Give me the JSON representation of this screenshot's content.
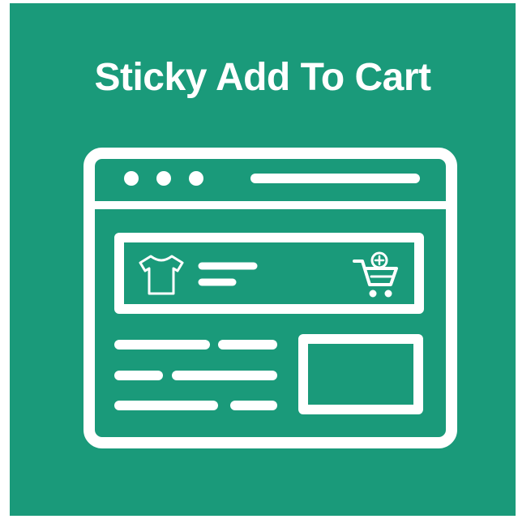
{
  "banner": {
    "title": "Sticky Add To Cart",
    "background_color": "#1a9a7a",
    "foreground_color": "#ffffff"
  },
  "illustration": {
    "window_icon": "browser-window-icon",
    "product_icon": "tshirt-icon",
    "cart_icon": "cart-add-icon"
  }
}
